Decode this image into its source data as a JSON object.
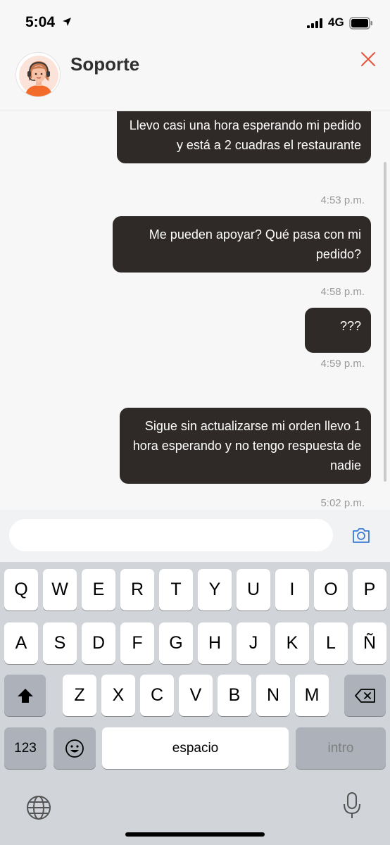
{
  "status_bar": {
    "time": "5:04",
    "network": "4G"
  },
  "header": {
    "title": "Soporte"
  },
  "messages": [
    {
      "text": "Llevo casi una hora esperando mi pedido y está a 2 cuadras el restaurante",
      "time": "4:53 p.m."
    },
    {
      "text": "Me pueden apoyar? Qué pasa con mi pedido?",
      "time": "4:58 p.m."
    },
    {
      "text": "???",
      "time": "4:59 p.m."
    },
    {
      "text": "Sigue sin actualizarse mi orden llevo 1 hora esperando y no tengo respuesta de nadie",
      "time": "5:02 p.m."
    }
  ],
  "input": {
    "value": "",
    "placeholder": ""
  },
  "keyboard": {
    "row1": [
      "Q",
      "W",
      "E",
      "R",
      "T",
      "Y",
      "U",
      "I",
      "O",
      "P"
    ],
    "row2": [
      "A",
      "S",
      "D",
      "F",
      "G",
      "H",
      "J",
      "K",
      "L",
      "Ñ"
    ],
    "row3": [
      "Z",
      "X",
      "C",
      "V",
      "B",
      "N",
      "M"
    ],
    "num_label": "123",
    "space_label": "espacio",
    "return_label": "intro"
  },
  "colors": {
    "bubble": "#2f2a28",
    "accent_close": "#e8543a",
    "camera": "#3a7bd5"
  },
  "icons": {
    "close": "close-icon",
    "camera": "camera-icon",
    "shift": "shift-icon",
    "delete": "delete-icon",
    "emoji": "emoji-icon",
    "globe": "globe-icon",
    "mic": "microphone-icon"
  }
}
